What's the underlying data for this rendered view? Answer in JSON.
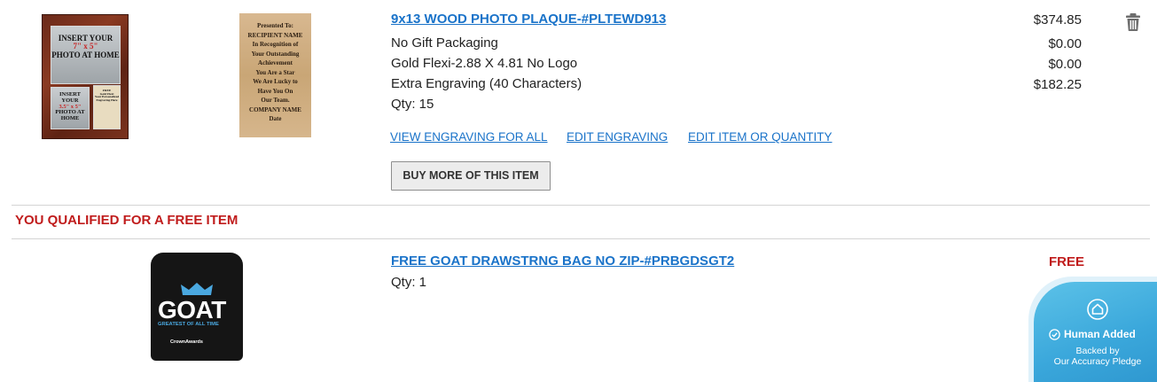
{
  "item": {
    "title": "9x13 WOOD PHOTO PLAQUE-#PLTEWD913",
    "price": "$374.85",
    "options": [
      {
        "label": "No Gift Packaging",
        "price": "$0.00"
      },
      {
        "label": "Gold Flexi-2.88 X 4.81 No Logo",
        "price": "$0.00"
      },
      {
        "label": "Extra Engraving (40 Characters)",
        "price": "$182.25"
      }
    ],
    "qty": "Qty: 15",
    "actions": {
      "view_engraving": "VIEW ENGRAVING FOR ALL",
      "edit_engraving": "EDIT ENGRAVING",
      "edit_item": "EDIT ITEM OR QUANTITY"
    },
    "buy_more": "BUY MORE OF THIS ITEM",
    "plaque_image": {
      "big_1": "INSERT YOUR",
      "big_2": "7\" x 5\"",
      "big_3": "PHOTO AT HOME",
      "small_1": "INSERT YOUR",
      "small_2": "3.5\" x 5\"",
      "small_3": "PHOTO AT HOME",
      "tag_1": "FREE",
      "tag_2": "Gold Flexi",
      "tag_3": "Your Personalized Engraving Here"
    },
    "engraving_image": {
      "lines": [
        "Presented To:",
        "RECIPIENT NAME",
        "In Recognition of",
        "Your Outstanding",
        "Achievement",
        "You Are a Star",
        "We Are Lucky to",
        "Have You On",
        "Our Team.",
        "COMPANY NAME",
        "Date"
      ]
    }
  },
  "promo": {
    "text": "YOU QUALIFIED FOR A FREE ITEM"
  },
  "free_item": {
    "title": "FREE GOAT DRAWSTRNG BAG NO ZIP-#PRBGDSGT2",
    "qty": "Qty: 1",
    "price": "FREE",
    "bag_image": {
      "word": "GOAT",
      "subtitle": "GREATEST OF ALL TIME",
      "brand": "CrownAwards"
    }
  },
  "badge": {
    "title": "Human Added",
    "line1": "Backed by",
    "line2": "Our Accuracy Pledge"
  },
  "colors": {
    "link": "#1a73c9",
    "promo_red": "#c01c1c",
    "badge_blue": "#3aa7db"
  },
  "icons": {
    "delete": "trash-icon",
    "badge": "shield-house-icon",
    "check": "check-circle-icon"
  }
}
